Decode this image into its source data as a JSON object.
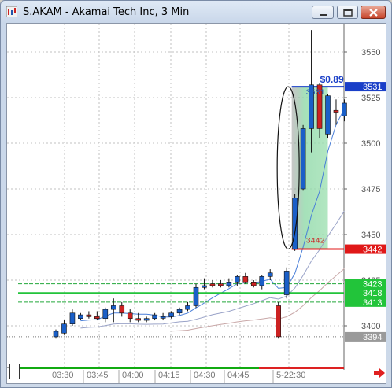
{
  "window": {
    "title": "S.AKAM - Akamai Tech Inc, 3 Min",
    "app_icon": "chart-app-icon",
    "controls": [
      "minimize-icon",
      "maximize-icon",
      "close-icon"
    ]
  },
  "chart_data": {
    "type": "candlestick",
    "symbol": "S.AKAM",
    "interval": "3 Min",
    "x_time_labels": [
      "03:30",
      "03:45",
      "04:00",
      "04:15",
      "04:30",
      "04:45",
      "5-22:30"
    ],
    "y_tick_labels": [
      "3550",
      "3525",
      "3500",
      "3475",
      "3450",
      "3425",
      "3400"
    ],
    "ylim": [
      3385,
      3565
    ],
    "grid": true,
    "candles": [
      {
        "o": 3394,
        "h": 3398,
        "l": 3393,
        "c": 3397
      },
      {
        "o": 3396,
        "h": 3403,
        "l": 3395,
        "c": 3401
      },
      {
        "o": 3401,
        "h": 3409,
        "l": 3400,
        "c": 3407
      },
      {
        "o": 3404,
        "h": 3407,
        "l": 3403,
        "c": 3406
      },
      {
        "o": 3406,
        "h": 3408,
        "l": 3404,
        "c": 3405
      },
      {
        "o": 3405,
        "h": 3408,
        "l": 3403,
        "c": 3404
      },
      {
        "o": 3404,
        "h": 3410,
        "l": 3402,
        "c": 3409
      },
      {
        "o": 3409,
        "h": 3415,
        "l": 3402,
        "c": 3411
      },
      {
        "o": 3411,
        "h": 3413,
        "l": 3405,
        "c": 3407
      },
      {
        "o": 3407,
        "h": 3409,
        "l": 3402,
        "c": 3404
      },
      {
        "o": 3404,
        "h": 3407,
        "l": 3402,
        "c": 3403
      },
      {
        "o": 3403,
        "h": 3405,
        "l": 3402,
        "c": 3404
      },
      {
        "o": 3404,
        "h": 3407,
        "l": 3403,
        "c": 3406
      },
      {
        "o": 3405,
        "h": 3407,
        "l": 3403,
        "c": 3405
      },
      {
        "o": 3405,
        "h": 3408,
        "l": 3404,
        "c": 3407
      },
      {
        "o": 3407,
        "h": 3410,
        "l": 3406,
        "c": 3409
      },
      {
        "o": 3409,
        "h": 3413,
        "l": 3408,
        "c": 3411
      },
      {
        "o": 3411,
        "h": 3423,
        "l": 3410,
        "c": 3421
      },
      {
        "o": 3421,
        "h": 3426,
        "l": 3420,
        "c": 3422
      },
      {
        "o": 3423,
        "h": 3425,
        "l": 3421,
        "c": 3422
      },
      {
        "o": 3423,
        "h": 3425,
        "l": 3421,
        "c": 3422
      },
      {
        "o": 3422,
        "h": 3426,
        "l": 3421,
        "c": 3424
      },
      {
        "o": 3424,
        "h": 3428,
        "l": 3422,
        "c": 3427
      },
      {
        "o": 3427,
        "h": 3429,
        "l": 3423,
        "c": 3424
      },
      {
        "o": 3424,
        "h": 3425,
        "l": 3421,
        "c": 3422
      },
      {
        "o": 3422,
        "h": 3428,
        "l": 3420,
        "c": 3427
      },
      {
        "o": 3427,
        "h": 3431,
        "l": 3425,
        "c": 3429
      },
      {
        "o": 3411,
        "h": 3413,
        "l": 3393,
        "c": 3394
      },
      {
        "o": 3417,
        "h": 3432,
        "l": 3415,
        "c": 3430
      },
      {
        "o": 3442,
        "h": 3472,
        "l": 3441,
        "c": 3470
      },
      {
        "o": 3475,
        "h": 3510,
        "l": 3474,
        "c": 3508
      },
      {
        "o": 3508,
        "h": 3562,
        "l": 3495,
        "c": 3532
      },
      {
        "o": 3532,
        "h": 3533,
        "l": 3503,
        "c": 3508
      },
      {
        "o": 3505,
        "h": 3527,
        "l": 3503,
        "c": 3526
      },
      {
        "o": 3518,
        "h": 3524,
        "l": 3510,
        "c": 3517
      },
      {
        "o": 3515,
        "h": 3524,
        "l": 3512,
        "c": 3522
      }
    ],
    "horizontal_levels": [
      {
        "value": 3531,
        "label": "3531",
        "tag_color": "#1a3fc8",
        "line_color": "#1a3fc8",
        "style": "solid"
      },
      {
        "value": 3442,
        "label": "3442",
        "tag_color": "#e01818",
        "line_color": "#e01818",
        "style": "solid"
      },
      {
        "value": 3423,
        "label": "3423",
        "tag_color": "#22c43a",
        "line_color": "#22a83a",
        "style": "dashed"
      },
      {
        "value": 3418,
        "label": "3418",
        "tag_color": "#22c43a",
        "line_color": "#22c43a",
        "style": "solid"
      },
      {
        "value": 3413,
        "label": "3413",
        "tag_color": "#22c43a",
        "line_color": "#22a83a",
        "style": "dashed"
      },
      {
        "value": 3394,
        "label": "3394",
        "tag_color": "#9a9a9a",
        "line_color": "#777777",
        "style": "dotted"
      }
    ],
    "measure_box": {
      "from": 3442,
      "to": 3531,
      "change_label": "$0.89",
      "top_label": "3531",
      "bottom_label": "3442"
    },
    "moving_averages": [
      {
        "color": "#4a7fd8"
      },
      {
        "color": "#9aa3c8"
      },
      {
        "color": "#c9a8a8"
      }
    ],
    "colors": {
      "up": "#1a5fc8",
      "down": "#cc2222",
      "grid": "#c0c0c0",
      "volume_up": "#11aa11",
      "volume_down": "#dd2222"
    }
  }
}
